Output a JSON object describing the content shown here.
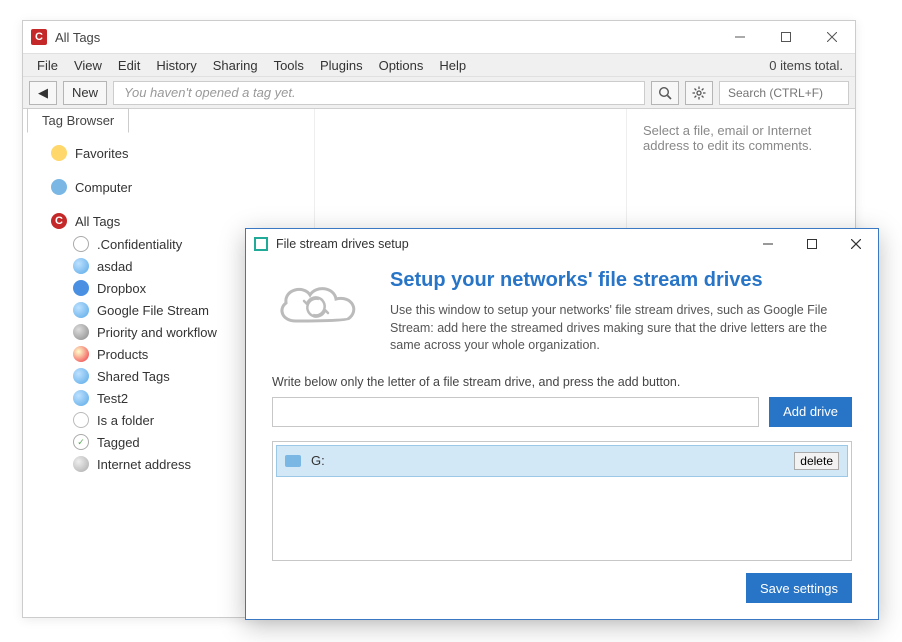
{
  "window": {
    "title": "All Tags",
    "app_icon_char": "C",
    "status_text": "0 items total."
  },
  "menu": [
    "File",
    "View",
    "Edit",
    "History",
    "Sharing",
    "Tools",
    "Plugins",
    "Options",
    "Help"
  ],
  "toolbar": {
    "back_glyph": "◀",
    "new_label": "New",
    "address_placeholder": "You haven't opened a tag yet.",
    "search_placeholder": "Search (CTRL+F)"
  },
  "tab_label": "Tag Browser",
  "sidebar": {
    "roots": [
      {
        "label": "Favorites",
        "ico": "ico-fav"
      },
      {
        "label": "Computer",
        "ico": "ico-comp"
      }
    ],
    "alltags_label": "All Tags",
    "icon_char": "C",
    "tags": [
      {
        "label": ".Confidentiality",
        "ico": "ico-conf"
      },
      {
        "label": "asdad",
        "ico": "ico-blue"
      },
      {
        "label": "Dropbox",
        "ico": "ico-dropbox"
      },
      {
        "label": "Google File Stream",
        "ico": "ico-google"
      },
      {
        "label": "Priority and workflow",
        "ico": "ico-grey"
      },
      {
        "label": "Products",
        "ico": "ico-red"
      },
      {
        "label": "Shared Tags",
        "ico": "ico-google"
      },
      {
        "label": "Test2",
        "ico": "ico-google"
      },
      {
        "label": "Is a folder",
        "ico": "ico-folder"
      },
      {
        "label": "Tagged",
        "ico": "ico-tagged"
      },
      {
        "label": "Internet address",
        "ico": "ico-internet"
      }
    ]
  },
  "right_hint": "Select a file, email or Internet address to edit its comments.",
  "dialog": {
    "title": "File stream drives setup",
    "heading": "Setup your networks' file stream drives",
    "desc": "Use this window to setup your networks' file stream drives, such as Google File Stream: add here the streamed drives making sure that the drive letters  are the same across your whole organization.",
    "input_label": "Write below only the letter of a file stream drive, and press the add button.",
    "input_value": "",
    "add_button": "Add drive",
    "drives": [
      {
        "label": "G:",
        "delete_label": "delete"
      }
    ],
    "save_button": "Save settings"
  }
}
